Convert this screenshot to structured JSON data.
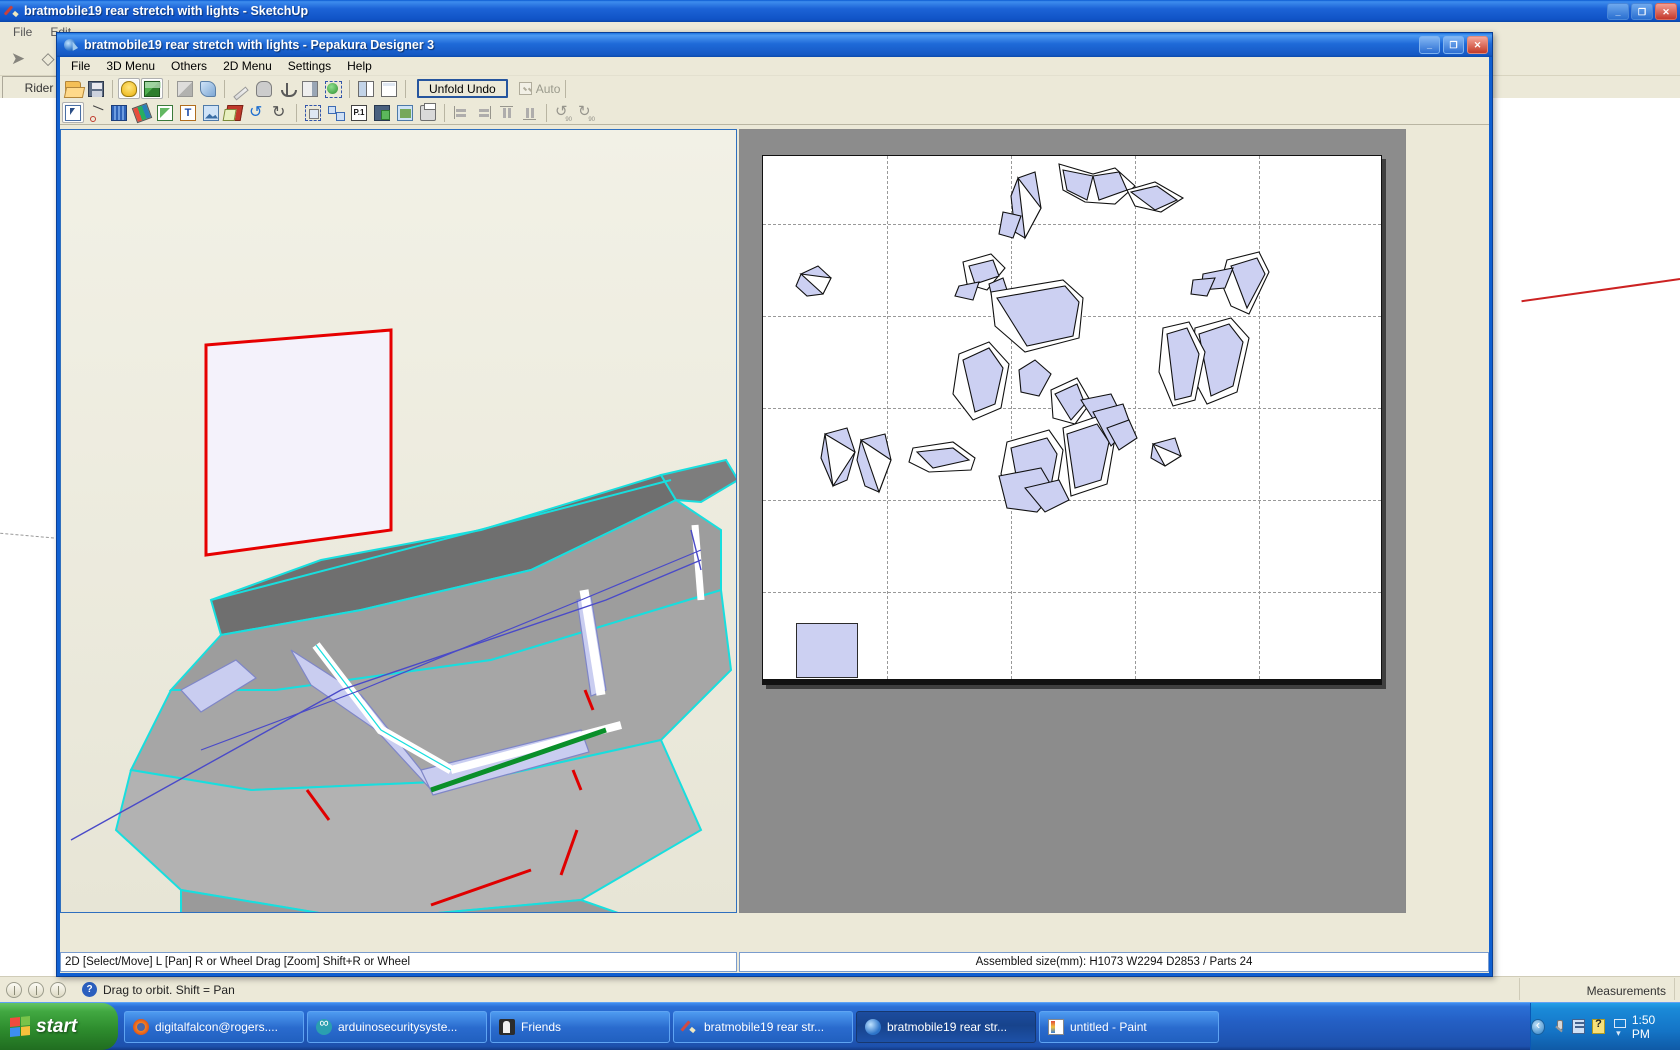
{
  "sketchup": {
    "title": "bratmobile19 rear stretch with lights - SketchUp",
    "icon": "sketchup-pencil-icon",
    "menus": [
      "File",
      "Edit"
    ],
    "tool_icons": [
      "select-arrow-icon",
      "eraser-icon"
    ],
    "tab_label": "Rider",
    "window_buttons": {
      "minimize": "_",
      "restore": "❐",
      "close": "✕"
    },
    "status": {
      "hint": "Drag to orbit.  Shift = Pan",
      "help_icon": "question-help-icon",
      "measurements_label": "Measurements",
      "measurement_value": ""
    }
  },
  "pepakura": {
    "title": "bratmobile19 rear stretch with lights - Pepakura Designer 3",
    "icon": "pepakura-globe-icon",
    "window_buttons": {
      "minimize": "_",
      "maximize": "❐",
      "close": "✕"
    },
    "menus": [
      "File",
      "3D Menu",
      "Others",
      "2D Menu",
      "Settings",
      "Help"
    ],
    "toolbar_row1": [
      {
        "name": "open-file-button",
        "icon": "folder-open-icon",
        "cls": "ico-open",
        "pressed": false
      },
      {
        "name": "save-file-button",
        "icon": "floppy-save-icon",
        "cls": "ico-save",
        "pressed": false
      },
      {
        "sep": true
      },
      {
        "name": "toggle-light-button",
        "icon": "lightbulb-icon",
        "cls": "ico-bulb",
        "pressed": true
      },
      {
        "name": "toggle-texture-button",
        "icon": "color-cube-icon",
        "cls": "ico-cube",
        "pressed": true
      },
      {
        "sep": true
      },
      {
        "name": "flat-shading-button",
        "icon": "gray-cube-icon",
        "cls": "ico-gray-cube",
        "pressed": false
      },
      {
        "name": "smooth-shading-button",
        "icon": "blue-shape-icon",
        "cls": "ico-blue-shape",
        "pressed": false
      },
      {
        "sep": true
      },
      {
        "name": "edge-edit-button",
        "icon": "pencil-icon",
        "cls": "ico-pencil",
        "pressed": false
      },
      {
        "name": "cylinder-tool-button",
        "icon": "cylinder-icon",
        "cls": "ico-cyl",
        "pressed": false
      },
      {
        "name": "anchor-tool-button",
        "icon": "anchor-icon",
        "cls": "ico-anchor",
        "pressed": false
      },
      {
        "name": "panel-view-button",
        "icon": "panel-icon",
        "cls": "ico-panel",
        "pressed": false
      },
      {
        "name": "select-face-button",
        "icon": "green-select-icon",
        "cls": "ico-selgreen",
        "pressed": false
      },
      {
        "sep": true
      },
      {
        "name": "split-view-button",
        "icon": "two-pane-window-icon",
        "cls": "ico-win2",
        "pressed": false
      },
      {
        "name": "single-view-button",
        "icon": "single-pane-window-icon",
        "cls": "ico-win1",
        "pressed": false
      }
    ],
    "unfold_undo_label": "Unfold Undo",
    "auto_label": "Auto",
    "auto_checked": true,
    "auto_enabled": false,
    "toolbar_row2": [
      {
        "name": "select-move-tool-button",
        "icon": "arrow-select-icon",
        "cls": "ico-arrowsel",
        "pressed": true
      },
      {
        "name": "join-split-face-button",
        "icon": "join-line-icon",
        "cls": "ico-joinline",
        "pressed": false
      },
      {
        "name": "scale-ruler-button",
        "icon": "ruler-icon",
        "cls": "ico-ruler",
        "pressed": false
      },
      {
        "name": "edge-color-button",
        "icon": "paintbrush-icon",
        "cls": "ico-paint",
        "pressed": false
      },
      {
        "name": "flap-edit-button",
        "icon": "flap-icon",
        "cls": "ico-flap",
        "pressed": false
      },
      {
        "name": "add-text-button",
        "icon": "text-tool-icon",
        "cls": "ico-text",
        "label": "T",
        "pressed": false
      },
      {
        "name": "add-image-button",
        "icon": "image-icon",
        "cls": "ico-image",
        "pressed": false
      },
      {
        "name": "unfold-tool-button",
        "icon": "unfold-icon",
        "cls": "ico-unfold",
        "pressed": false
      },
      {
        "name": "undo-button",
        "icon": "undo-arrow-icon",
        "cls": "ico-undo",
        "pressed": false
      },
      {
        "name": "redo-button",
        "icon": "redo-arrow-icon",
        "cls": "ico-redo",
        "pressed": false
      },
      {
        "sep": true
      },
      {
        "name": "selection-box-button",
        "icon": "dashed-select-icon",
        "cls": "ico-dashsel",
        "pressed": false
      },
      {
        "name": "auto-layout-button",
        "icon": "layout-icon",
        "cls": "ico-layout",
        "pressed": false
      },
      {
        "name": "page-setup-button",
        "icon": "page-one-icon",
        "cls": "ico-p1",
        "label": "P.1",
        "pressed": false
      },
      {
        "name": "save-as-button",
        "icon": "save-green-icon",
        "cls": "ico-savegreen",
        "pressed": false
      },
      {
        "name": "export-image-button",
        "icon": "export-image-icon",
        "cls": "ico-export",
        "pressed": false
      },
      {
        "name": "print-button",
        "icon": "printer-icon",
        "cls": "ico-print",
        "pressed": false
      },
      {
        "sep": true
      },
      {
        "name": "align-left-button",
        "icon": "align-left-icon",
        "cls": "ico-alignl",
        "pressed": false
      },
      {
        "name": "align-right-button",
        "icon": "align-right-icon",
        "cls": "ico-alignr",
        "pressed": false
      },
      {
        "name": "align-top-button",
        "icon": "align-top-icon",
        "cls": "ico-alignt",
        "pressed": false
      },
      {
        "name": "align-bottom-button",
        "icon": "align-bottom-icon",
        "cls": "ico-alignb",
        "pressed": false
      },
      {
        "sep": true
      },
      {
        "name": "rotate-left-90-button",
        "icon": "rotate-left-90-icon",
        "cls": "ico-rot90l",
        "pressed": false
      },
      {
        "name": "rotate-right-90-button",
        "icon": "rotate-right-90-icon",
        "cls": "ico-rot90r",
        "pressed": false
      }
    ],
    "status_left": "2D [Select/Move] L [Pan] R or Wheel Drag [Zoom] Shift+R or Wheel",
    "status_right": "Assembled size(mm): H1073 W2294 D2853 / Parts 24",
    "colors": {
      "part_fill": "#ccd0f2",
      "part_stroke": "#111111",
      "selected_face": "#ff0000",
      "model_edge": "#00e5e5",
      "pane_background": "#8c8c8c",
      "sheet_background": "#ffffff"
    }
  },
  "taskbar": {
    "start_label": "start",
    "items": [
      {
        "name": "taskbar-item-firefox-mail",
        "label": "digitalfalcon@rogers....",
        "icon": "firefox-icon",
        "icon_cls": "ti-firefox",
        "active": false
      },
      {
        "name": "taskbar-item-arduino",
        "label": "arduinosecuritysyste...",
        "icon": "arduino-icon",
        "icon_cls": "ti-arduino",
        "active": false
      },
      {
        "name": "taskbar-item-friends",
        "label": "Friends",
        "icon": "friends-icon",
        "icon_cls": "ti-friends",
        "active": false
      },
      {
        "name": "taskbar-item-sketchup",
        "label": "bratmobile19 rear str...",
        "icon": "sketchup-icon",
        "icon_cls": "ti-sketchup",
        "active": false
      },
      {
        "name": "taskbar-item-pepakura",
        "label": "bratmobile19 rear str...",
        "icon": "pepakura-icon",
        "icon_cls": "ti-pepakura",
        "active": true
      },
      {
        "name": "taskbar-item-paint",
        "label": "untitled - Paint",
        "icon": "paint-icon",
        "icon_cls": "ti-paint",
        "active": false
      }
    ],
    "tray_icons": [
      {
        "name": "microphone-tray-icon",
        "cls": "ti-mic"
      },
      {
        "name": "notes-tray-icon",
        "cls": "ti-note"
      },
      {
        "name": "help-tray-icon",
        "cls": "ti-q"
      },
      {
        "name": "dual-display-tray-icon",
        "cls": "ti-dual"
      }
    ],
    "time": "1:50 PM"
  }
}
